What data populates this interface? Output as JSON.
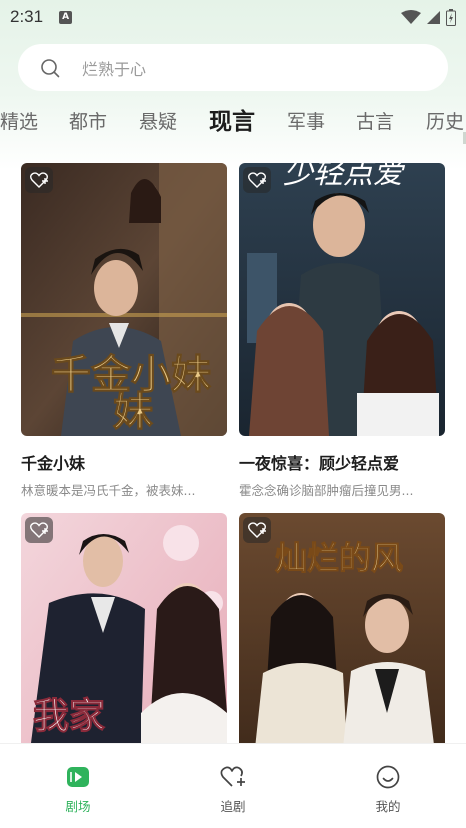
{
  "status_bar": {
    "time": "2:31",
    "notification_letter": "A"
  },
  "search": {
    "placeholder": "烂熟于心"
  },
  "tabs": [
    {
      "label": "精选"
    },
    {
      "label": "都市"
    },
    {
      "label": "悬疑"
    },
    {
      "label": "现言",
      "active": true
    },
    {
      "label": "军事"
    },
    {
      "label": "古言"
    },
    {
      "label": "历史"
    }
  ],
  "dramas": [
    {
      "title": "千金小妹",
      "desc": "林意暖本是冯氏千金，被表妹...",
      "poster_text": "千金小妹"
    },
    {
      "title": "一夜惊喜：顾少轻点爱",
      "desc": "霍念念确诊脑部肿瘤后撞见男...",
      "poster_text": "少轻点爱"
    },
    {
      "title": "",
      "desc": "",
      "poster_text": "我家"
    },
    {
      "title": "",
      "desc": "",
      "poster_text": "灿烂的风"
    }
  ],
  "bottom_nav": [
    {
      "label": "剧场",
      "active": true
    },
    {
      "label": "追剧"
    },
    {
      "label": "我的"
    }
  ],
  "colors": {
    "accent": "#2fb35c",
    "tab_active": "#1d1d1d",
    "tab_inactive": "#6a6a6a"
  }
}
